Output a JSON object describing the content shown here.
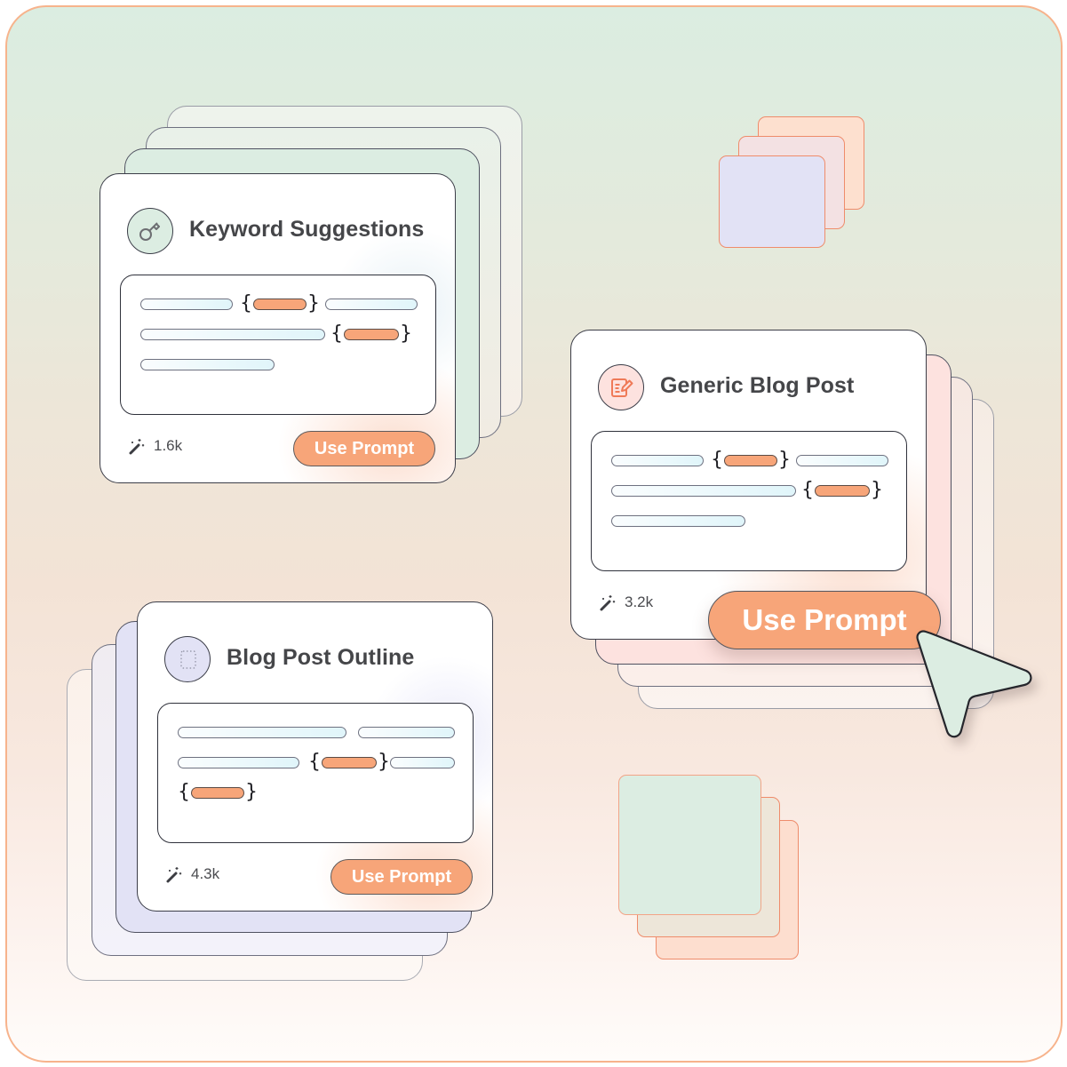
{
  "cards": [
    {
      "id": "keyword-suggestions",
      "title": "Keyword Suggestions",
      "icon": "key-icon",
      "uses": "1.6k",
      "button_label": "Use Prompt",
      "accent": "#dcede2"
    },
    {
      "id": "generic-blog-post",
      "title": "Generic Blog Post",
      "icon": "edit-document-icon",
      "uses": "3.2k",
      "button_label": "Use Prompt",
      "accent": "#fde2df"
    },
    {
      "id": "blog-post-outline",
      "title": "Blog Post Outline",
      "icon": "dotted-square-icon",
      "uses": "4.3k",
      "button_label": "Use Prompt",
      "accent": "#e2e2f5"
    }
  ],
  "colors": {
    "primary_button": "#f7a579",
    "frame_border": "#f7b38c",
    "variable_pill": "#f7a579",
    "text_pill": "#e0f5fa",
    "cursor_fill": "#dcede2"
  },
  "stat_icon": "magic-wand-icon",
  "cursor_icon": "pointer-cursor-icon"
}
